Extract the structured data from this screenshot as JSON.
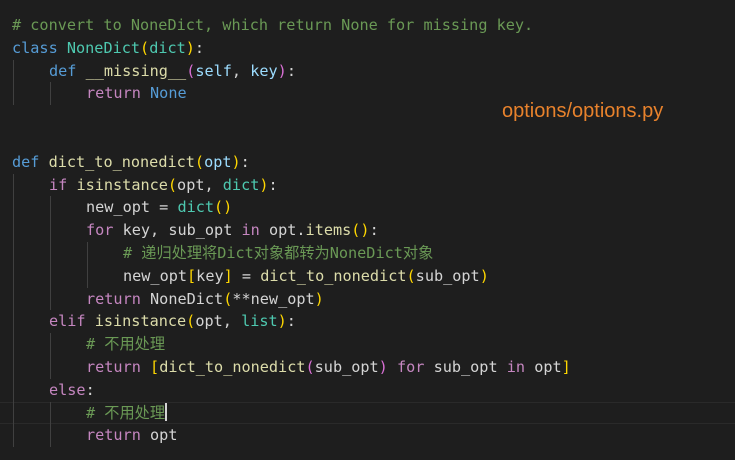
{
  "overlay_label": "options/options.py",
  "theme": {
    "background": "#1e1e1e",
    "label_color": "#e8822c"
  },
  "lines": [
    {
      "indent": 0,
      "tokens": [
        {
          "t": "# convert to NoneDict, which return None for missing key.",
          "k": "comment"
        }
      ]
    },
    {
      "indent": 0,
      "tokens": [
        {
          "t": "class",
          "k": "keyword"
        },
        {
          "t": " "
        },
        {
          "t": "NoneDict",
          "k": "class"
        },
        {
          "t": "(",
          "k": "bracket1"
        },
        {
          "t": "dict",
          "k": "builtin"
        },
        {
          "t": ")",
          "k": "bracket1"
        },
        {
          "t": ":",
          "k": "punct"
        }
      ]
    },
    {
      "indent": 1,
      "tokens": [
        {
          "t": "def",
          "k": "keyword"
        },
        {
          "t": " "
        },
        {
          "t": "__missing__",
          "k": "function"
        },
        {
          "t": "(",
          "k": "bracket2"
        },
        {
          "t": "self",
          "k": "param"
        },
        {
          "t": ", ",
          "k": "punct"
        },
        {
          "t": "key",
          "k": "param"
        },
        {
          "t": ")",
          "k": "bracket2"
        },
        {
          "t": ":",
          "k": "punct"
        }
      ]
    },
    {
      "indent": 2,
      "tokens": [
        {
          "t": "return",
          "k": "control"
        },
        {
          "t": " "
        },
        {
          "t": "None",
          "k": "keyword"
        }
      ]
    },
    {
      "indent": 0,
      "tokens": []
    },
    {
      "indent": 0,
      "tokens": []
    },
    {
      "indent": 0,
      "tokens": [
        {
          "t": "def",
          "k": "keyword"
        },
        {
          "t": " "
        },
        {
          "t": "dict_to_nonedict",
          "k": "function"
        },
        {
          "t": "(",
          "k": "bracket1"
        },
        {
          "t": "opt",
          "k": "param"
        },
        {
          "t": ")",
          "k": "bracket1"
        },
        {
          "t": ":",
          "k": "punct"
        }
      ]
    },
    {
      "indent": 1,
      "tokens": [
        {
          "t": "if",
          "k": "control"
        },
        {
          "t": " "
        },
        {
          "t": "isinstance",
          "k": "function"
        },
        {
          "t": "(",
          "k": "bracket1"
        },
        {
          "t": "opt",
          "k": "var"
        },
        {
          "t": ", ",
          "k": "punct"
        },
        {
          "t": "dict",
          "k": "builtin"
        },
        {
          "t": ")",
          "k": "bracket1"
        },
        {
          "t": ":",
          "k": "punct"
        }
      ]
    },
    {
      "indent": 2,
      "tokens": [
        {
          "t": "new_opt",
          "k": "var"
        },
        {
          "t": " = ",
          "k": "op"
        },
        {
          "t": "dict",
          "k": "builtin"
        },
        {
          "t": "()",
          "k": "bracket1"
        }
      ]
    },
    {
      "indent": 2,
      "tokens": [
        {
          "t": "for",
          "k": "control"
        },
        {
          "t": " "
        },
        {
          "t": "key",
          "k": "var"
        },
        {
          "t": ", ",
          "k": "punct"
        },
        {
          "t": "sub_opt",
          "k": "var"
        },
        {
          "t": " "
        },
        {
          "t": "in",
          "k": "control"
        },
        {
          "t": " "
        },
        {
          "t": "opt",
          "k": "var"
        },
        {
          "t": ".",
          "k": "punct"
        },
        {
          "t": "items",
          "k": "function"
        },
        {
          "t": "()",
          "k": "bracket1"
        },
        {
          "t": ":",
          "k": "punct"
        }
      ]
    },
    {
      "indent": 3,
      "tokens": [
        {
          "t": "# 递归处理将Dict对象都转为NoneDict对象",
          "k": "comment"
        }
      ]
    },
    {
      "indent": 3,
      "tokens": [
        {
          "t": "new_opt",
          "k": "var"
        },
        {
          "t": "[",
          "k": "bracket1"
        },
        {
          "t": "key",
          "k": "var"
        },
        {
          "t": "]",
          "k": "bracket1"
        },
        {
          "t": " = ",
          "k": "op"
        },
        {
          "t": "dict_to_nonedict",
          "k": "function"
        },
        {
          "t": "(",
          "k": "bracket1"
        },
        {
          "t": "sub_opt",
          "k": "var"
        },
        {
          "t": ")",
          "k": "bracket1"
        }
      ]
    },
    {
      "indent": 2,
      "tokens": [
        {
          "t": "return",
          "k": "control"
        },
        {
          "t": " "
        },
        {
          "t": "NoneDict",
          "k": "var"
        },
        {
          "t": "(",
          "k": "bracket1"
        },
        {
          "t": "**",
          "k": "op"
        },
        {
          "t": "new_opt",
          "k": "var"
        },
        {
          "t": ")",
          "k": "bracket1"
        }
      ]
    },
    {
      "indent": 1,
      "tokens": [
        {
          "t": "elif",
          "k": "control"
        },
        {
          "t": " "
        },
        {
          "t": "isinstance",
          "k": "function"
        },
        {
          "t": "(",
          "k": "bracket1"
        },
        {
          "t": "opt",
          "k": "var"
        },
        {
          "t": ", ",
          "k": "punct"
        },
        {
          "t": "list",
          "k": "builtin"
        },
        {
          "t": ")",
          "k": "bracket1"
        },
        {
          "t": ":",
          "k": "punct"
        }
      ]
    },
    {
      "indent": 2,
      "tokens": [
        {
          "t": "# 不用处理",
          "k": "comment"
        }
      ]
    },
    {
      "indent": 2,
      "tokens": [
        {
          "t": "return",
          "k": "control"
        },
        {
          "t": " "
        },
        {
          "t": "[",
          "k": "bracket1"
        },
        {
          "t": "dict_to_nonedict",
          "k": "function"
        },
        {
          "t": "(",
          "k": "bracket2"
        },
        {
          "t": "sub_opt",
          "k": "var"
        },
        {
          "t": ")",
          "k": "bracket2"
        },
        {
          "t": " "
        },
        {
          "t": "for",
          "k": "control"
        },
        {
          "t": " "
        },
        {
          "t": "sub_opt",
          "k": "var"
        },
        {
          "t": " "
        },
        {
          "t": "in",
          "k": "control"
        },
        {
          "t": " "
        },
        {
          "t": "opt",
          "k": "var"
        },
        {
          "t": "]",
          "k": "bracket1"
        }
      ]
    },
    {
      "indent": 1,
      "tokens": [
        {
          "t": "else",
          "k": "control"
        },
        {
          "t": ":",
          "k": "punct"
        }
      ]
    },
    {
      "indent": 2,
      "cursor": true,
      "tokens": [
        {
          "t": "# 不用处理",
          "k": "comment"
        }
      ]
    },
    {
      "indent": 2,
      "tokens": [
        {
          "t": "return",
          "k": "control"
        },
        {
          "t": " "
        },
        {
          "t": "opt",
          "k": "var"
        }
      ]
    }
  ]
}
